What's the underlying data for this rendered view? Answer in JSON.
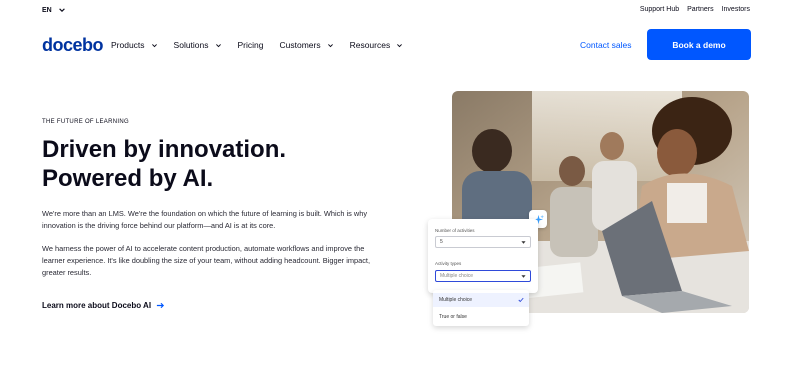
{
  "utility": {
    "language": "EN",
    "links": [
      "Support Hub",
      "Partners",
      "Investors"
    ]
  },
  "nav": {
    "logo": "docebo",
    "menu": [
      "Products",
      "Solutions",
      "Pricing",
      "Customers",
      "Resources"
    ],
    "contact_label": "Contact sales",
    "demo_label": "Book a demo"
  },
  "hero": {
    "eyebrow": "THE FUTURE OF LEARNING",
    "headline": "Driven by innovation. Powered by AI.",
    "paragraph1": "We're more than an LMS. We're the foundation on which the future of learning is built. Which is why innovation is the driving force behind our platform—and AI is at its core.",
    "paragraph2": "We harness the power of AI to accelerate content production, automate workflows and improve the learner experience. It's like doubling the size of your team, without adding headcount. Bigger impact, greater results.",
    "learn_more": "Learn more about Docebo AI"
  },
  "form_card": {
    "activities_label": "Number of activities",
    "activities_value": "5",
    "types_label": "Activity types",
    "types_placeholder": "Multiple choice",
    "options": [
      "Multiple choice",
      "True or false"
    ]
  },
  "colors": {
    "brand": "#0033a0",
    "accent": "#0057ff",
    "text": "#0b0b1a"
  }
}
